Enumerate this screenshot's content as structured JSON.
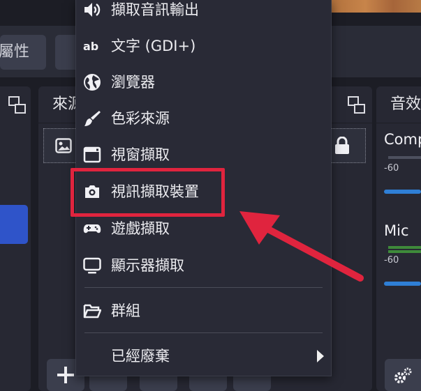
{
  "properties_bar": {
    "properties_label": "屬性"
  },
  "sources_dock": {
    "title": "來源"
  },
  "mixer_dock": {
    "title": "音效",
    "channels": [
      {
        "name": "Comp",
        "tick": "-60"
      },
      {
        "name": "Mic",
        "tick": "-60"
      }
    ]
  },
  "context_menu": {
    "items": [
      {
        "label": "擷取音訊輸出",
        "icon": "speaker-icon"
      },
      {
        "label": "文字 (GDI+)",
        "icon": "text-ab-icon"
      },
      {
        "label": "瀏覽器",
        "icon": "globe-icon"
      },
      {
        "label": "色彩來源",
        "icon": "paint-brush-icon"
      },
      {
        "label": "視窗擷取",
        "icon": "window-icon"
      },
      {
        "label": "視訊擷取裝置",
        "icon": "camera-icon",
        "highlighted": true
      },
      {
        "label": "遊戲擷取",
        "icon": "gamepad-icon"
      },
      {
        "label": "顯示器擷取",
        "icon": "monitor-icon"
      },
      {
        "label": "群組",
        "icon": "folder-icon"
      },
      {
        "label": "已經廢棄",
        "icon": "submenu-arrow-icon"
      }
    ]
  },
  "colors": {
    "highlight_border": "#e0243e",
    "arrow": "#e0243e",
    "accent_blue": "#2f54c9"
  }
}
